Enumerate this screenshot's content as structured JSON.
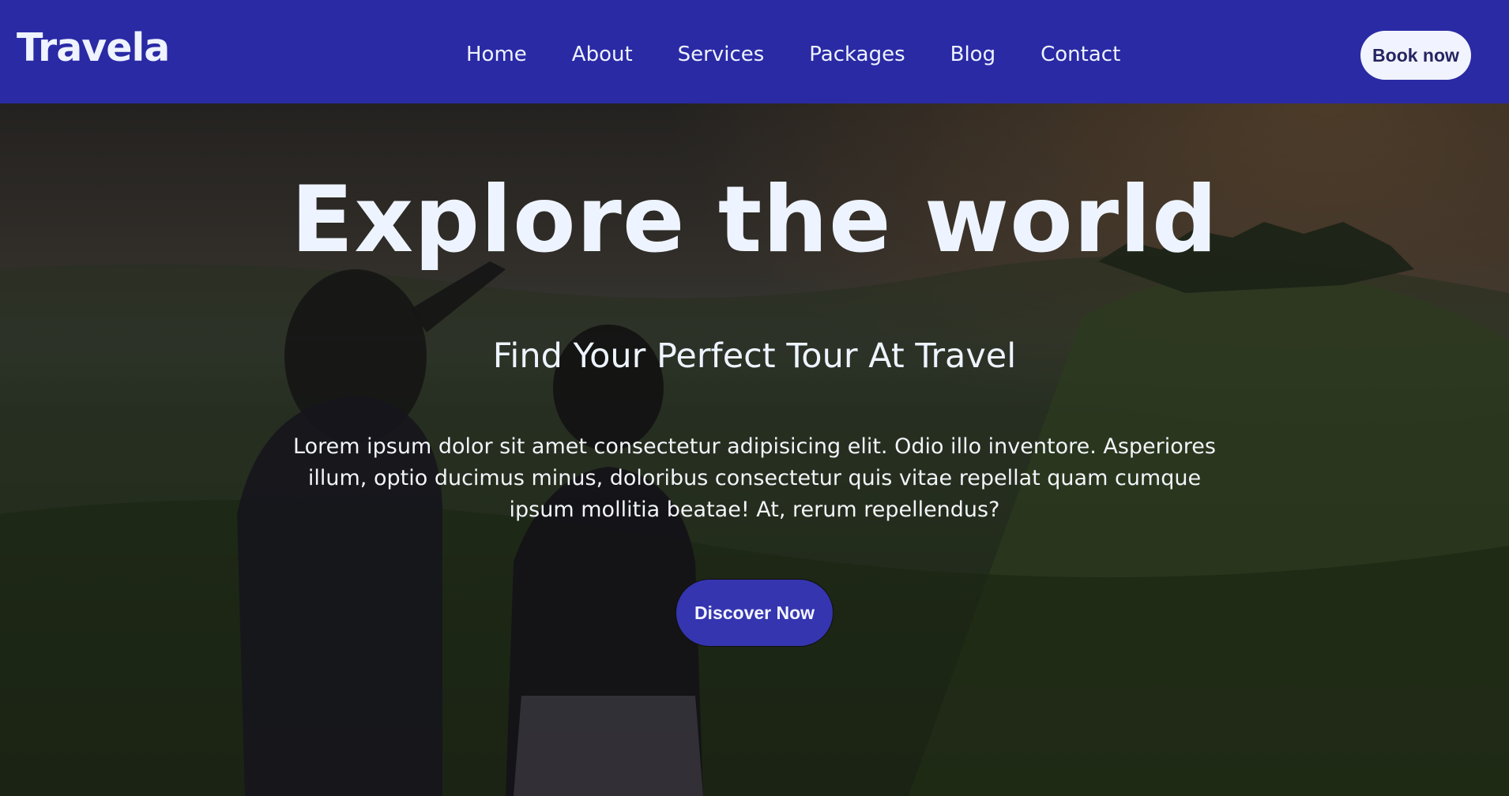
{
  "nav": {
    "brand": "Travela",
    "links": [
      "Home",
      "About",
      "Services",
      "Packages",
      "Blog",
      "Contact"
    ],
    "book_label": "Book now"
  },
  "hero": {
    "title": "Explore the world",
    "subtitle": "Find Your Perfect Tour At Travel",
    "body": "Lorem ipsum dolor sit amet consectetur adipisicing elit. Odio illo inventore. Asperiores illum, optio ducimus minus, doloribus consectetur quis vitae repellat quam cumque ipsum mollitia beatae! At, rerum repellendus?",
    "cta_label": "Discover Now"
  },
  "colors": {
    "navbar": "#2a2aa5",
    "cta": "#3535b0",
    "text_light": "#eef4ff"
  }
}
